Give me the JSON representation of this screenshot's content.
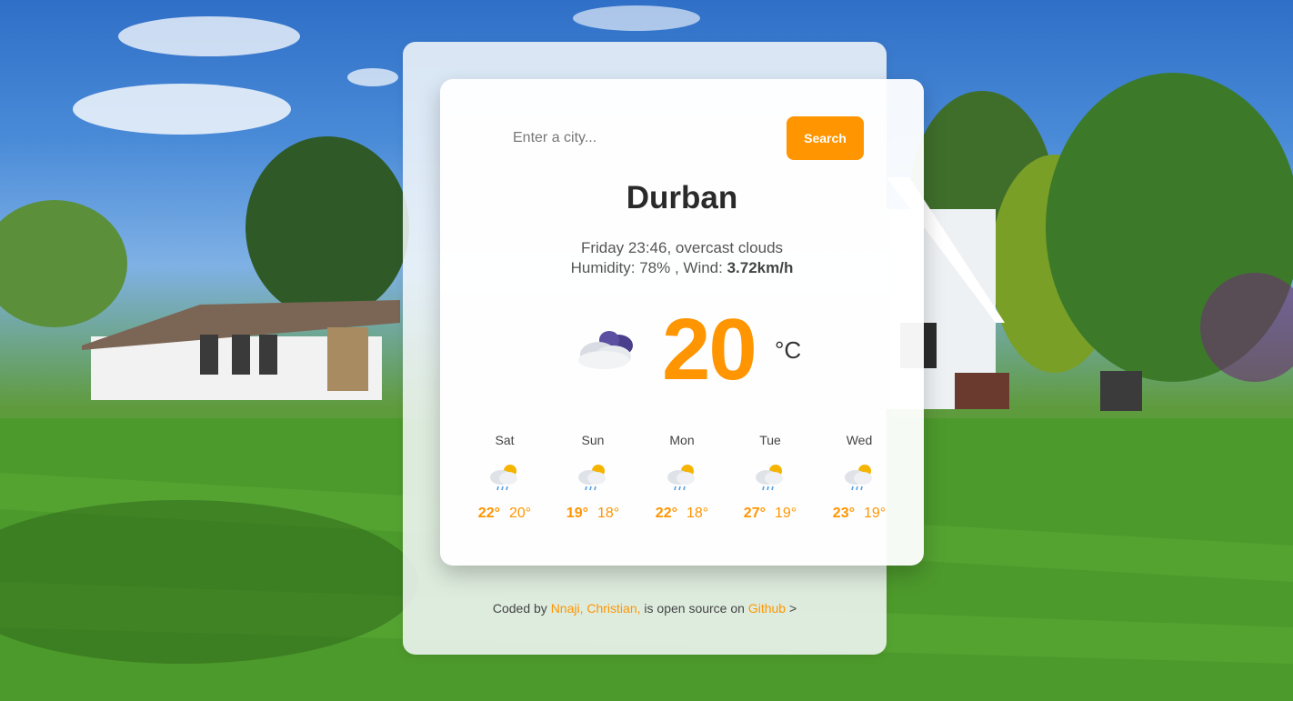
{
  "search": {
    "placeholder": "Enter a city...",
    "button_label": "Search"
  },
  "weather": {
    "city": "Durban",
    "day_time": "Friday 23:46",
    "description": "overcast clouds",
    "humidity_label": "Humidity: ",
    "humidity": "78%",
    "wind_label": "Wind: ",
    "wind": "3.72km/h",
    "temperature": "20",
    "unit": "°C",
    "icon": "overcast-clouds-icon"
  },
  "forecast": [
    {
      "day": "Sat",
      "high": "22°",
      "low": "20°",
      "icon": "sun-rain-cloud-icon"
    },
    {
      "day": "Sun",
      "high": "19°",
      "low": "18°",
      "icon": "sun-rain-cloud-icon"
    },
    {
      "day": "Mon",
      "high": "22°",
      "low": "18°",
      "icon": "sun-rain-cloud-icon"
    },
    {
      "day": "Tue",
      "high": "27°",
      "low": "19°",
      "icon": "sun-rain-cloud-icon"
    },
    {
      "day": "Wed",
      "high": "23°",
      "low": "19°",
      "icon": "sun-rain-cloud-icon"
    }
  ],
  "footer": {
    "prefix": "Coded by ",
    "author": "Nnaji, Christian,",
    "middle": " is open source on ",
    "repo": "Github",
    "suffix": " >"
  },
  "colors": {
    "accent": "#ff9500",
    "text_dark": "#2a2a2a"
  }
}
